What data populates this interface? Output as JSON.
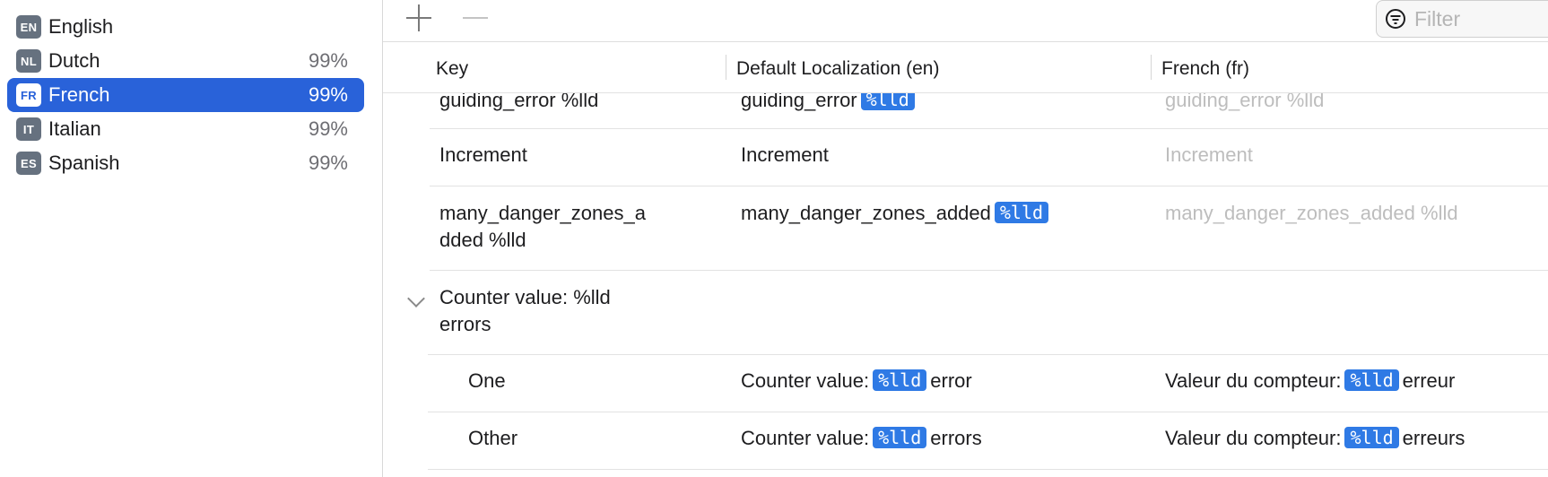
{
  "sidebar": {
    "languages": [
      {
        "code": "EN",
        "name": "English",
        "percent": ""
      },
      {
        "code": "NL",
        "name": "Dutch",
        "percent": "99%"
      },
      {
        "code": "FR",
        "name": "French",
        "percent": "99%",
        "selected": true
      },
      {
        "code": "IT",
        "name": "Italian",
        "percent": "99%"
      },
      {
        "code": "ES",
        "name": "Spanish",
        "percent": "99%"
      }
    ]
  },
  "toolbar": {
    "filter_placeholder": "Filter"
  },
  "table": {
    "columns": {
      "key": "Key",
      "default": "Default Localization (en)",
      "french": "French (fr)"
    },
    "token": "%lld",
    "rows": [
      {
        "key": "guiding_error %lld",
        "default_text": "guiding_error",
        "french": "guiding_error %lld"
      },
      {
        "key": "Increment",
        "default_text": "Increment",
        "french": "Increment"
      },
      {
        "key_line1": "many_danger_zones_a",
        "key_line2": "dded %lld",
        "default_text": "many_danger_zones_added",
        "french": "many_danger_zones_added %lld"
      },
      {
        "key_line1": "Counter value: %lld",
        "key_line2": "errors"
      },
      {
        "key": "One",
        "default_before": "Counter value:",
        "default_after": "error",
        "french_before": "Valeur du compteur:",
        "french_after": "erreur"
      },
      {
        "key": "Other",
        "default_before": "Counter value:",
        "default_after": "errors",
        "french_before": "Valeur du compteur:",
        "french_after": "erreurs"
      }
    ]
  }
}
